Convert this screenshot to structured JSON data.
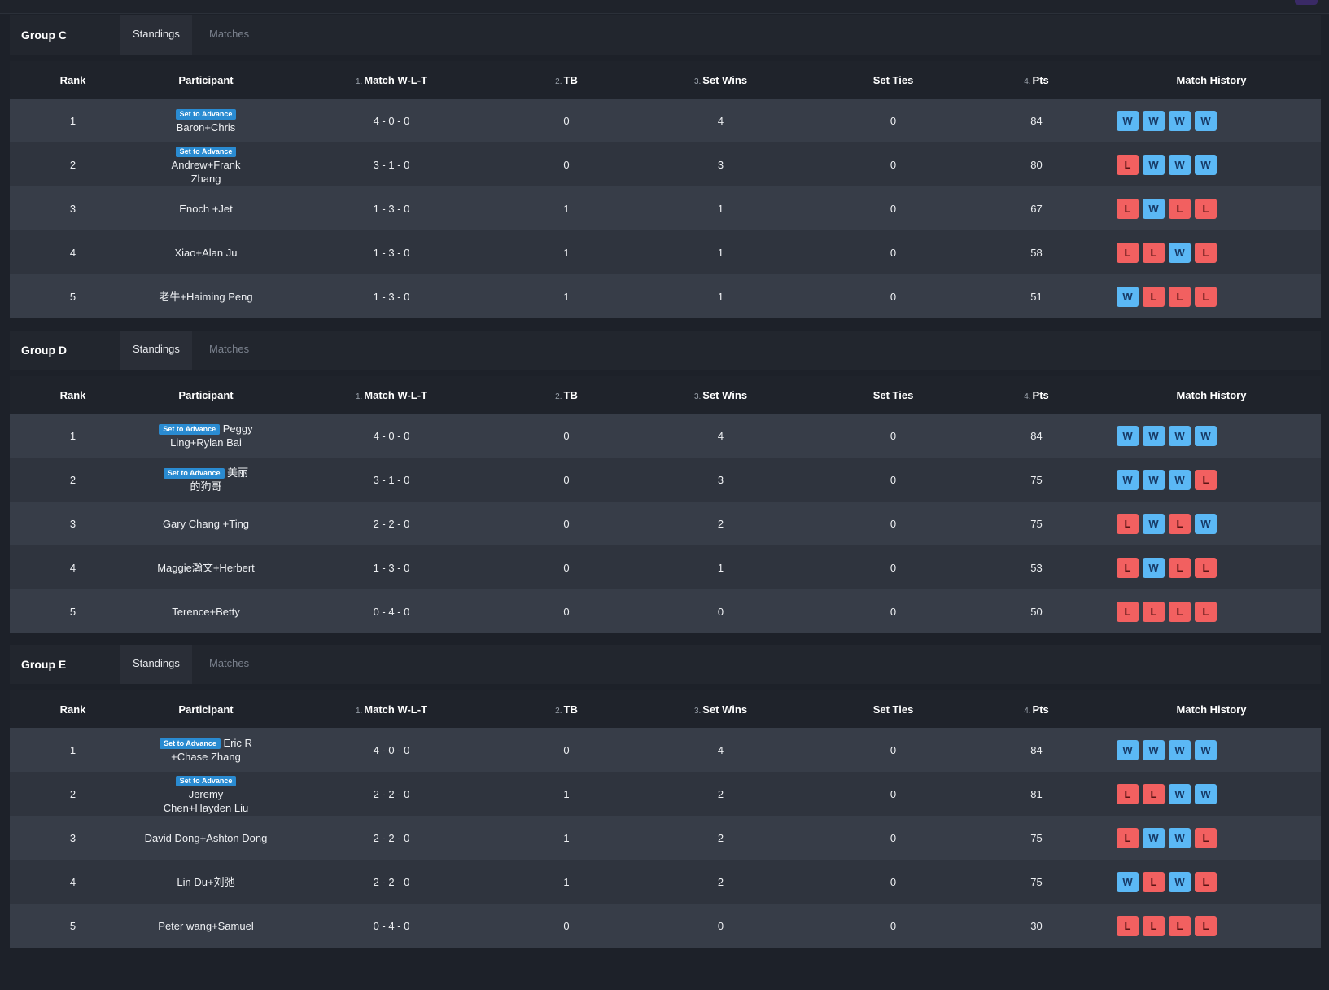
{
  "colors": {
    "win": "#5bb8f5",
    "loss": "#f26060",
    "badge": "#2a8bd1"
  },
  "columns": {
    "rank": "Rank",
    "participant": "Participant",
    "match_wlt": {
      "num": "1.",
      "label": "Match W-L-T"
    },
    "tb": {
      "num": "2.",
      "label": "TB"
    },
    "set_wins": {
      "num": "3.",
      "label": "Set Wins"
    },
    "set_ties": "Set Ties",
    "pts": {
      "num": "4.",
      "label": "Pts"
    },
    "history": "Match History"
  },
  "badge_text": "Set to Advance",
  "groups": [
    {
      "name": "Group C",
      "tabs": [
        "Standings",
        "Matches"
      ],
      "rows": [
        {
          "rank": "1",
          "advance": true,
          "name": "Baron+Chris",
          "wlt": "4 - 0 - 0",
          "tb": "0",
          "set_wins": "4",
          "set_ties": "0",
          "pts": "84",
          "history": [
            "W",
            "W",
            "W",
            "W"
          ]
        },
        {
          "rank": "2",
          "advance": true,
          "name": "Andrew+Frank Zhang",
          "wlt": "3 - 1 - 0",
          "tb": "0",
          "set_wins": "3",
          "set_ties": "0",
          "pts": "80",
          "history": [
            "L",
            "W",
            "W",
            "W"
          ]
        },
        {
          "rank": "3",
          "advance": false,
          "name": "Enoch +Jet",
          "wlt": "1 - 3 - 0",
          "tb": "1",
          "set_wins": "1",
          "set_ties": "0",
          "pts": "67",
          "history": [
            "L",
            "W",
            "L",
            "L"
          ]
        },
        {
          "rank": "4",
          "advance": false,
          "name": "Xiao+Alan Ju",
          "wlt": "1 - 3 - 0",
          "tb": "1",
          "set_wins": "1",
          "set_ties": "0",
          "pts": "58",
          "history": [
            "L",
            "L",
            "W",
            "L"
          ]
        },
        {
          "rank": "5",
          "advance": false,
          "name": "老牛+Haiming Peng",
          "wlt": "1 - 3 - 0",
          "tb": "1",
          "set_wins": "1",
          "set_ties": "0",
          "pts": "51",
          "history": [
            "W",
            "L",
            "L",
            "L"
          ]
        }
      ]
    },
    {
      "name": "Group D",
      "tabs": [
        "Standings",
        "Matches"
      ],
      "rows": [
        {
          "rank": "1",
          "advance": true,
          "name": "Peggy Ling+Rylan Bai",
          "wlt": "4 - 0 - 0",
          "tb": "0",
          "set_wins": "4",
          "set_ties": "0",
          "pts": "84",
          "history": [
            "W",
            "W",
            "W",
            "W"
          ]
        },
        {
          "rank": "2",
          "advance": true,
          "name": "美丽的狗哥",
          "wlt": "3 - 1 - 0",
          "tb": "0",
          "set_wins": "3",
          "set_ties": "0",
          "pts": "75",
          "history": [
            "W",
            "W",
            "W",
            "L"
          ]
        },
        {
          "rank": "3",
          "advance": false,
          "name": "Gary Chang +Ting",
          "wlt": "2 - 2 - 0",
          "tb": "0",
          "set_wins": "2",
          "set_ties": "0",
          "pts": "75",
          "history": [
            "L",
            "W",
            "L",
            "W"
          ]
        },
        {
          "rank": "4",
          "advance": false,
          "name": "Maggie瀚文+Herbert",
          "wlt": "1 - 3 - 0",
          "tb": "0",
          "set_wins": "1",
          "set_ties": "0",
          "pts": "53",
          "history": [
            "L",
            "W",
            "L",
            "L"
          ]
        },
        {
          "rank": "5",
          "advance": false,
          "name": "Terence+Betty",
          "wlt": "0 - 4 - 0",
          "tb": "0",
          "set_wins": "0",
          "set_ties": "0",
          "pts": "50",
          "history": [
            "L",
            "L",
            "L",
            "L"
          ]
        }
      ]
    },
    {
      "name": "Group E",
      "tabs": [
        "Standings",
        "Matches"
      ],
      "rows": [
        {
          "rank": "1",
          "advance": true,
          "name": "Eric R +Chase Zhang",
          "wlt": "4 - 0 - 0",
          "tb": "0",
          "set_wins": "4",
          "set_ties": "0",
          "pts": "84",
          "history": [
            "W",
            "W",
            "W",
            "W"
          ]
        },
        {
          "rank": "2",
          "advance": true,
          "name": "Jeremy Chen+Hayden Liu",
          "wlt": "2 - 2 - 0",
          "tb": "1",
          "set_wins": "2",
          "set_ties": "0",
          "pts": "81",
          "history": [
            "L",
            "L",
            "W",
            "W"
          ]
        },
        {
          "rank": "3",
          "advance": false,
          "name": "David Dong+Ashton Dong",
          "wlt": "2 - 2 - 0",
          "tb": "1",
          "set_wins": "2",
          "set_ties": "0",
          "pts": "75",
          "history": [
            "L",
            "W",
            "W",
            "L"
          ]
        },
        {
          "rank": "4",
          "advance": false,
          "name": "Lin Du+刘弛",
          "wlt": "2 - 2 - 0",
          "tb": "1",
          "set_wins": "2",
          "set_ties": "0",
          "pts": "75",
          "history": [
            "W",
            "L",
            "W",
            "L"
          ]
        },
        {
          "rank": "5",
          "advance": false,
          "name": "Peter wang+Samuel",
          "wlt": "0 - 4 - 0",
          "tb": "0",
          "set_wins": "0",
          "set_ties": "0",
          "pts": "30",
          "history": [
            "L",
            "L",
            "L",
            "L"
          ]
        }
      ]
    }
  ]
}
